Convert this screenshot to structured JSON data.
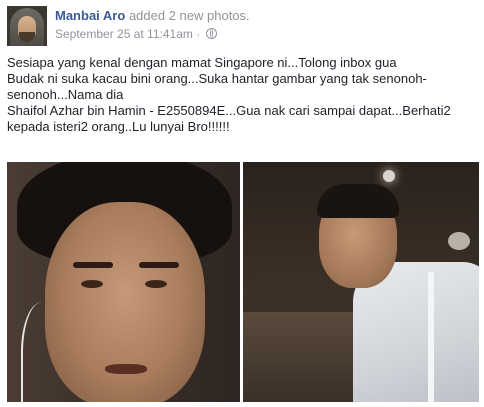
{
  "post": {
    "author": "Manbai Aro",
    "action": "added 2 new photos.",
    "timestamp": "September 25 at 11:41am",
    "separator": "·",
    "text_lines": [
      "Sesiapa yang kenal dengan mamat Singapore ni...Tolong inbox gua",
      "Budak ni suka kacau bini orang...Suka hantar gambar yang tak senonoh-",
      "senonoh...Nama dia",
      "Shaifol Azhar bin Hamin - E2550894E...Gua nak cari sampai dapat...Berhati2",
      "kepada isteri2 orang..Lu lunyai Bro!!!!!!"
    ],
    "privacy_icon": "globe-icon",
    "photos": [
      "photo-1",
      "photo-2"
    ]
  },
  "colors": {
    "author_link": "#3b5998",
    "meta_text": "#90949c",
    "body_text": "#1d2129"
  }
}
